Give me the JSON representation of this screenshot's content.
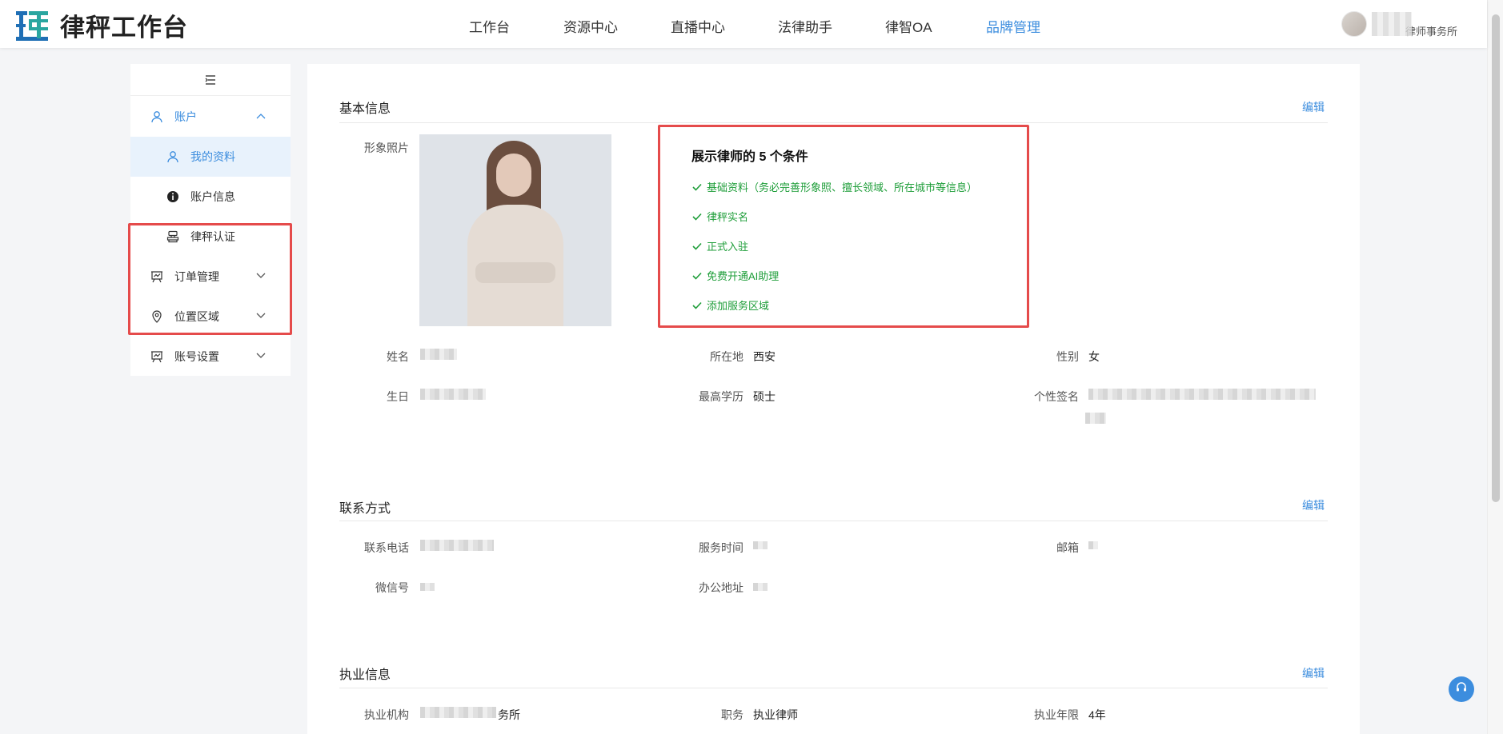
{
  "app": {
    "title": "律秤工作台"
  },
  "nav": {
    "items": [
      "工作台",
      "资源中心",
      "直播中心",
      "法律助手",
      "律智OA",
      "品牌管理"
    ],
    "active_index": 5
  },
  "user": {
    "firm_suffix": "律师事务所"
  },
  "sidebar": {
    "toggle_icon": "menu-collapse-icon",
    "items": [
      {
        "label": "账户",
        "icon": "user-icon"
      },
      {
        "label": "我的资料",
        "icon": "user-icon"
      },
      {
        "label": "账户信息",
        "icon": "info-icon"
      },
      {
        "label": "律秤认证",
        "icon": "stamp-icon"
      },
      {
        "label": "订单管理",
        "icon": "presentation-icon"
      },
      {
        "label": "位置区域",
        "icon": "location-pin-icon"
      },
      {
        "label": "账号设置",
        "icon": "presentation-icon"
      }
    ]
  },
  "basic": {
    "title": "基本信息",
    "edit": "编辑",
    "photo_label": "形象照片",
    "name_label": "姓名",
    "location_label": "所在地",
    "location_value": "西安",
    "gender_label": "性别",
    "gender_value": "女",
    "birthday_label": "生日",
    "education_label": "最高学历",
    "education_value": "硕士",
    "signature_label": "个性签名"
  },
  "conditions": {
    "title": "展示律师的 5 个条件",
    "items": [
      "基础资料（务必完善形象照、擅长领域、所在城市等信息）",
      "律秤实名",
      "正式入驻",
      "免费开通AI助理",
      "添加服务区域"
    ]
  },
  "contact": {
    "title": "联系方式",
    "edit": "编辑",
    "phone_label": "联系电话",
    "service_time_label": "服务时间",
    "email_label": "邮箱",
    "wechat_label": "微信号",
    "office_label": "办公地址"
  },
  "practice": {
    "title": "执业信息",
    "edit": "编辑",
    "org_label": "执业机构",
    "org_suffix": "务所",
    "position_label": "职务",
    "position_value": "执业律师",
    "years_label": "执业年限",
    "years_value": "4年"
  },
  "colors": {
    "accent": "#3c8dde",
    "highlight_border": "#e54b4b",
    "check_green": "#1f9e3a"
  }
}
